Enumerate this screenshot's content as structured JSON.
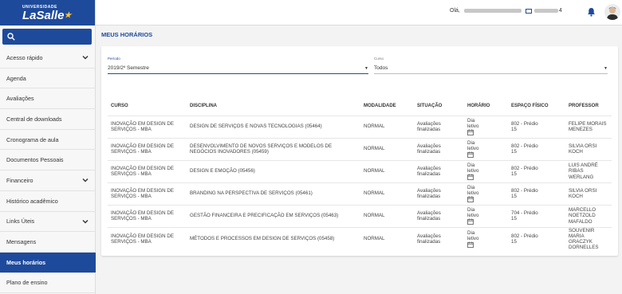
{
  "logo": {
    "top_text": "UNIVERSIDADE",
    "main_text": "LaSalle"
  },
  "sidebar": {
    "items": [
      {
        "label": "Acesso rápido",
        "has_chevron": true
      },
      {
        "label": "Agenda",
        "has_chevron": false
      },
      {
        "label": "Avaliações",
        "has_chevron": false
      },
      {
        "label": "Central de downloads",
        "has_chevron": false
      },
      {
        "label": "Cronograma de aula",
        "has_chevron": false
      },
      {
        "label": "Documentos Pessoais",
        "has_chevron": false
      },
      {
        "label": "Financeiro",
        "has_chevron": true
      },
      {
        "label": "Histórico acadêmico",
        "has_chevron": false
      },
      {
        "label": "Links Úteis",
        "has_chevron": true
      },
      {
        "label": "Mensagens",
        "has_chevron": false
      },
      {
        "label": "Meus horários",
        "has_chevron": false,
        "active": true
      },
      {
        "label": "Plano de ensino",
        "has_chevron": false
      }
    ]
  },
  "header": {
    "greeting": "Olá,",
    "id_suffix": "4"
  },
  "page": {
    "title": "MEUS HORÁRIOS"
  },
  "filters": {
    "periodo": {
      "label": "Período",
      "value": "2019/2º Semestre"
    },
    "curso": {
      "label": "Curso",
      "value": "Todos"
    }
  },
  "table": {
    "headers": [
      "CURSO",
      "DISCIPLINA",
      "MODALIDADE",
      "SITUAÇÃO",
      "HORÁRIO",
      "ESPAÇO FÍSICO",
      "PROFESSOR"
    ],
    "rows": [
      {
        "curso": "INOVAÇÃO EM DESIGN DE SERVIÇOS - MBA",
        "disciplina": "DESIGN DE SERVIÇOS E NOVAS TECNOLOGIAS (05464)",
        "modalidade": "NORMAL",
        "situacao": "Avaliações finalizadas",
        "horario": "Dia letivo",
        "espaco": "802 - Prédio 15",
        "professor": "FELIPE MORAIS MENEZES"
      },
      {
        "curso": "INOVAÇÃO EM DESIGN DE SERVIÇOS - MBA",
        "disciplina": "DESENVOLVIMENTO DE NOVOS SERVIÇOS E MODELOS DE NEGÓCIOS INOVADORES (05459)",
        "modalidade": "NORMAL",
        "situacao": "Avaliações finalizadas",
        "horario": "Dia letivo",
        "espaco": "802 - Prédio 15",
        "professor": "SILVIA ORSI KOCH"
      },
      {
        "curso": "INOVAÇÃO EM DESIGN DE SERVIÇOS - MBA",
        "disciplina": "DESIGN E EMOÇÃO (05456)",
        "modalidade": "NORMAL",
        "situacao": "Avaliações finalizadas",
        "horario": "Dia letivo",
        "espaco": "802 - Prédio 15",
        "professor": "LUIS ANDRÉ RIBAS WERLANG"
      },
      {
        "curso": "INOVAÇÃO EM DESIGN DE SERVIÇOS - MBA",
        "disciplina": "BRANDING NA PERSPECTIVA DE SERVIÇOS (05461)",
        "modalidade": "NORMAL",
        "situacao": "Avaliações finalizadas",
        "horario": "Dia letivo",
        "espaco": "802 - Prédio 15",
        "professor": "SILVIA ORSI KOCH"
      },
      {
        "curso": "INOVAÇÃO EM DESIGN DE SERVIÇOS - MBA",
        "disciplina": "GESTÃO FINANCEIRA E PRECIFICAÇÃO EM SERVIÇOS (05463)",
        "modalidade": "NORMAL",
        "situacao": "Avaliações finalizadas",
        "horario": "Dia letivo",
        "espaco": "704 - Prédio 15",
        "professor": "MARCELLO NOETZOLD MAFALDO"
      },
      {
        "curso": "INOVAÇÃO EM DESIGN DE SERVIÇOS - MBA",
        "disciplina": "MÉTODOS E PROCESSOS EM DESIGN DE SERVIÇOS (05458)",
        "modalidade": "NORMAL",
        "situacao": "Avaliações finalizadas",
        "horario": "Dia letivo",
        "espaco": "802 - Prédio 15",
        "professor": "SOUVENIR MARIA GRACZYK DORNELLES"
      }
    ]
  },
  "colors": {
    "brand": "#1e4a9b",
    "accent_star": "#f6c343"
  },
  "icons": {
    "search": "search-icon",
    "chevron": "chevron-down-icon",
    "bell": "bell-icon",
    "calendar": "calendar-icon"
  }
}
